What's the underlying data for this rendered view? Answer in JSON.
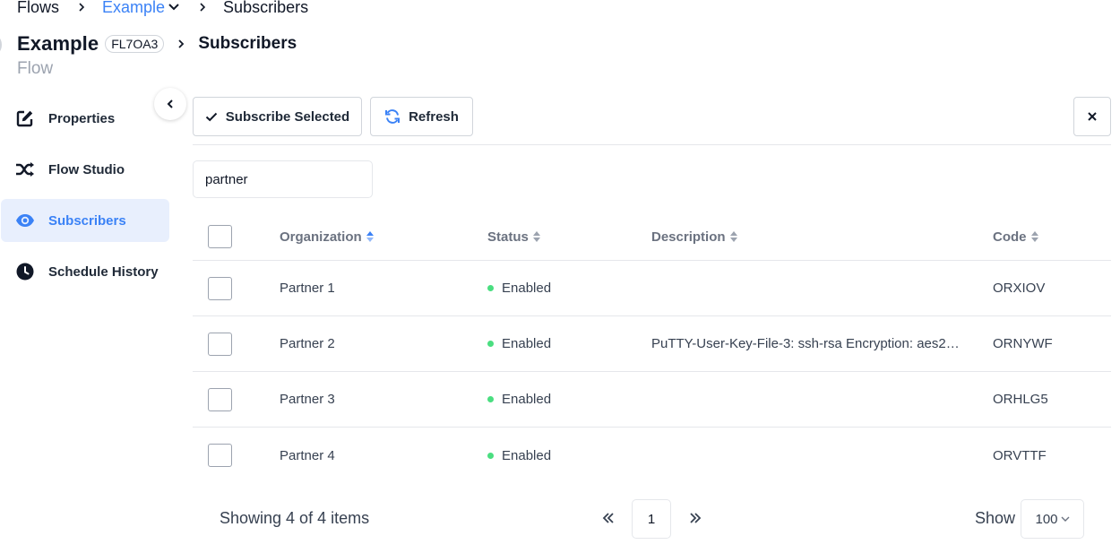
{
  "breadcrumb": {
    "flows": "Flows",
    "flow_name": "Example",
    "current": "Subscribers"
  },
  "header": {
    "title": "Example",
    "badge": "FL7OA3",
    "section": "Subscribers",
    "subtitle": "Flow"
  },
  "sidebar": {
    "items": [
      {
        "label": "Properties",
        "icon": "edit-icon"
      },
      {
        "label": "Flow Studio",
        "icon": "shuffle-icon"
      },
      {
        "label": "Subscribers",
        "icon": "eye-icon",
        "active": true
      },
      {
        "label": "Schedule History",
        "icon": "clock-icon"
      }
    ]
  },
  "toolbar": {
    "subscribe_label": "Subscribe Selected",
    "refresh_label": "Refresh",
    "close_icon": "close-icon"
  },
  "search": {
    "value": "partner"
  },
  "table": {
    "columns": [
      "Organization",
      "Status",
      "Description",
      "Code"
    ],
    "rows": [
      {
        "organization": "Partner 1",
        "status": "Enabled",
        "description": "",
        "code": "ORXIOV"
      },
      {
        "organization": "Partner 2",
        "status": "Enabled",
        "description": "PuTTY-User-Key-File-3: ssh-rsa Encryption: aes256...",
        "code": "ORNYWF"
      },
      {
        "organization": "Partner 3",
        "status": "Enabled",
        "description": "",
        "code": "ORHLG5"
      },
      {
        "organization": "Partner 4",
        "status": "Enabled",
        "description": "",
        "code": "ORVTTF"
      }
    ]
  },
  "pagination": {
    "summary": "Showing 4 of 4 items",
    "current_page": "1",
    "show_label": "Show",
    "page_size": "100"
  },
  "colors": {
    "accent": "#3b82f6",
    "active_bg": "#e8effd",
    "status_enabled": "#4ade80"
  }
}
